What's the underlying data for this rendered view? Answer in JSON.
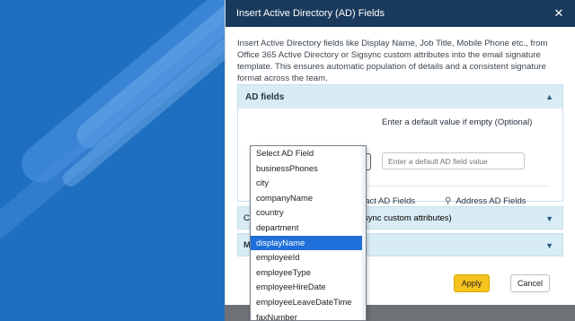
{
  "panel": {
    "title": "Insert Active Directory (AD) Fields",
    "intro": "Insert Active Directory fields like Display Name, Job Title, Mobile Phone etc., from Office 365 Active Directory or Sigsync custom attributes into the email signature template. This ensures automatic population of details and a consistent signature format across the team."
  },
  "ad_fields": {
    "header": "AD fields",
    "default_label": "Enter a default value if empty (Optional)",
    "default_placeholder": "Enter a default AD field value",
    "selected_field": "displayName",
    "tab_contact": "ontact AD Fields",
    "tab_address": "Address AD Fields"
  },
  "custom_attrs": {
    "head_left": "C",
    "head_right": "sync custom attributes)"
  },
  "third_section": {
    "head_left": "M"
  },
  "dropdown": {
    "items": [
      "Select AD Field",
      "businessPhones",
      "city",
      "companyName",
      "country",
      "department",
      "displayName",
      "employeeId",
      "employeeType",
      "employeeHireDate",
      "employeeLeaveDateTime",
      "faxNumber"
    ],
    "selected_index": 6
  },
  "buttons": {
    "apply": "Apply",
    "cancel": "Cancel"
  },
  "colors": {
    "header_bg": "#1a3a5c",
    "accent_yellow": "#f6c21c",
    "selection_blue": "#1e6fd9",
    "section_bg": "#d8ecf5",
    "left_bg": "#1f6fc0"
  }
}
